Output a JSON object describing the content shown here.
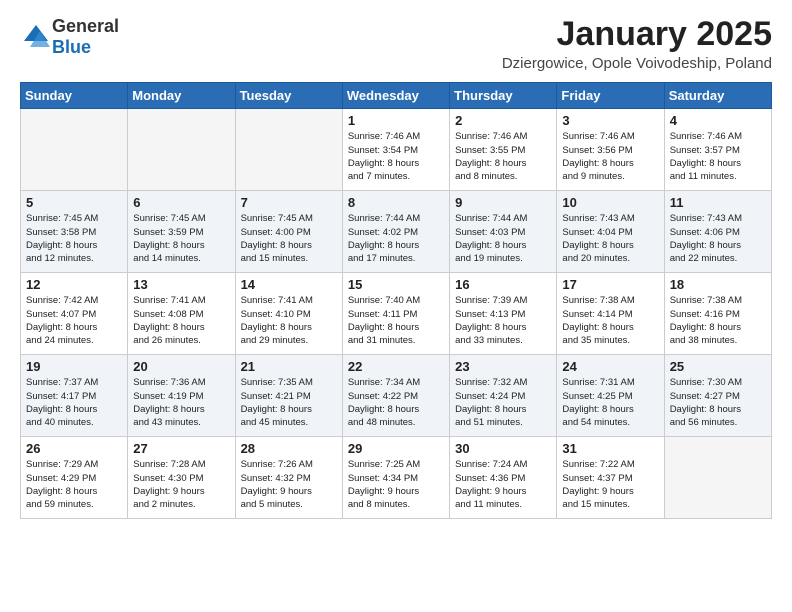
{
  "header": {
    "logo_general": "General",
    "logo_blue": "Blue",
    "month": "January 2025",
    "location": "Dziergowice, Opole Voivodeship, Poland"
  },
  "weekdays": [
    "Sunday",
    "Monday",
    "Tuesday",
    "Wednesday",
    "Thursday",
    "Friday",
    "Saturday"
  ],
  "weeks": [
    [
      {
        "day": "",
        "info": ""
      },
      {
        "day": "",
        "info": ""
      },
      {
        "day": "",
        "info": ""
      },
      {
        "day": "1",
        "info": "Sunrise: 7:46 AM\nSunset: 3:54 PM\nDaylight: 8 hours\nand 7 minutes."
      },
      {
        "day": "2",
        "info": "Sunrise: 7:46 AM\nSunset: 3:55 PM\nDaylight: 8 hours\nand 8 minutes."
      },
      {
        "day": "3",
        "info": "Sunrise: 7:46 AM\nSunset: 3:56 PM\nDaylight: 8 hours\nand 9 minutes."
      },
      {
        "day": "4",
        "info": "Sunrise: 7:46 AM\nSunset: 3:57 PM\nDaylight: 8 hours\nand 11 minutes."
      }
    ],
    [
      {
        "day": "5",
        "info": "Sunrise: 7:45 AM\nSunset: 3:58 PM\nDaylight: 8 hours\nand 12 minutes."
      },
      {
        "day": "6",
        "info": "Sunrise: 7:45 AM\nSunset: 3:59 PM\nDaylight: 8 hours\nand 14 minutes."
      },
      {
        "day": "7",
        "info": "Sunrise: 7:45 AM\nSunset: 4:00 PM\nDaylight: 8 hours\nand 15 minutes."
      },
      {
        "day": "8",
        "info": "Sunrise: 7:44 AM\nSunset: 4:02 PM\nDaylight: 8 hours\nand 17 minutes."
      },
      {
        "day": "9",
        "info": "Sunrise: 7:44 AM\nSunset: 4:03 PM\nDaylight: 8 hours\nand 19 minutes."
      },
      {
        "day": "10",
        "info": "Sunrise: 7:43 AM\nSunset: 4:04 PM\nDaylight: 8 hours\nand 20 minutes."
      },
      {
        "day": "11",
        "info": "Sunrise: 7:43 AM\nSunset: 4:06 PM\nDaylight: 8 hours\nand 22 minutes."
      }
    ],
    [
      {
        "day": "12",
        "info": "Sunrise: 7:42 AM\nSunset: 4:07 PM\nDaylight: 8 hours\nand 24 minutes."
      },
      {
        "day": "13",
        "info": "Sunrise: 7:41 AM\nSunset: 4:08 PM\nDaylight: 8 hours\nand 26 minutes."
      },
      {
        "day": "14",
        "info": "Sunrise: 7:41 AM\nSunset: 4:10 PM\nDaylight: 8 hours\nand 29 minutes."
      },
      {
        "day": "15",
        "info": "Sunrise: 7:40 AM\nSunset: 4:11 PM\nDaylight: 8 hours\nand 31 minutes."
      },
      {
        "day": "16",
        "info": "Sunrise: 7:39 AM\nSunset: 4:13 PM\nDaylight: 8 hours\nand 33 minutes."
      },
      {
        "day": "17",
        "info": "Sunrise: 7:38 AM\nSunset: 4:14 PM\nDaylight: 8 hours\nand 35 minutes."
      },
      {
        "day": "18",
        "info": "Sunrise: 7:38 AM\nSunset: 4:16 PM\nDaylight: 8 hours\nand 38 minutes."
      }
    ],
    [
      {
        "day": "19",
        "info": "Sunrise: 7:37 AM\nSunset: 4:17 PM\nDaylight: 8 hours\nand 40 minutes."
      },
      {
        "day": "20",
        "info": "Sunrise: 7:36 AM\nSunset: 4:19 PM\nDaylight: 8 hours\nand 43 minutes."
      },
      {
        "day": "21",
        "info": "Sunrise: 7:35 AM\nSunset: 4:21 PM\nDaylight: 8 hours\nand 45 minutes."
      },
      {
        "day": "22",
        "info": "Sunrise: 7:34 AM\nSunset: 4:22 PM\nDaylight: 8 hours\nand 48 minutes."
      },
      {
        "day": "23",
        "info": "Sunrise: 7:32 AM\nSunset: 4:24 PM\nDaylight: 8 hours\nand 51 minutes."
      },
      {
        "day": "24",
        "info": "Sunrise: 7:31 AM\nSunset: 4:25 PM\nDaylight: 8 hours\nand 54 minutes."
      },
      {
        "day": "25",
        "info": "Sunrise: 7:30 AM\nSunset: 4:27 PM\nDaylight: 8 hours\nand 56 minutes."
      }
    ],
    [
      {
        "day": "26",
        "info": "Sunrise: 7:29 AM\nSunset: 4:29 PM\nDaylight: 8 hours\nand 59 minutes."
      },
      {
        "day": "27",
        "info": "Sunrise: 7:28 AM\nSunset: 4:30 PM\nDaylight: 9 hours\nand 2 minutes."
      },
      {
        "day": "28",
        "info": "Sunrise: 7:26 AM\nSunset: 4:32 PM\nDaylight: 9 hours\nand 5 minutes."
      },
      {
        "day": "29",
        "info": "Sunrise: 7:25 AM\nSunset: 4:34 PM\nDaylight: 9 hours\nand 8 minutes."
      },
      {
        "day": "30",
        "info": "Sunrise: 7:24 AM\nSunset: 4:36 PM\nDaylight: 9 hours\nand 11 minutes."
      },
      {
        "day": "31",
        "info": "Sunrise: 7:22 AM\nSunset: 4:37 PM\nDaylight: 9 hours\nand 15 minutes."
      },
      {
        "day": "",
        "info": ""
      }
    ]
  ]
}
